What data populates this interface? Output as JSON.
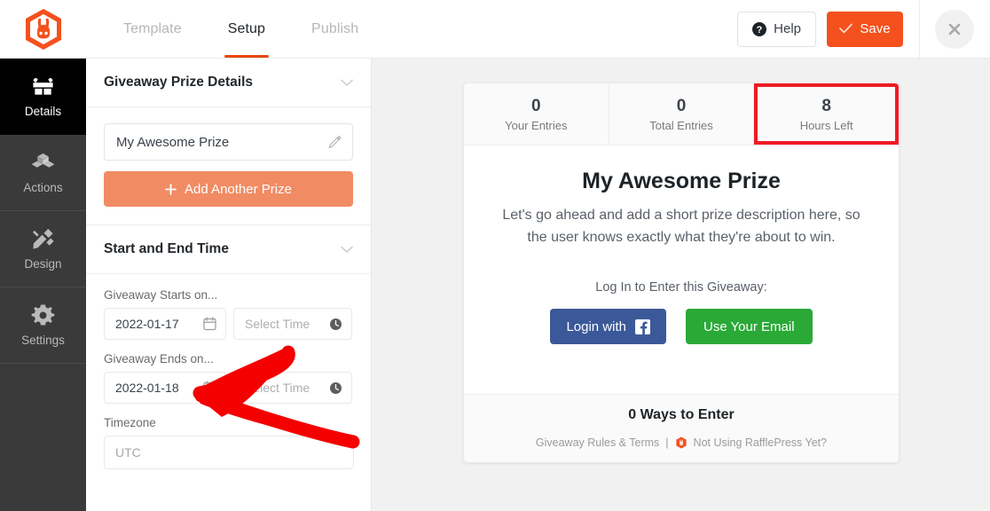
{
  "header": {
    "logo_icon": "rafflepress-bunny-logo",
    "tabs": [
      {
        "label": "Template",
        "active": false
      },
      {
        "label": "Setup",
        "active": true
      },
      {
        "label": "Publish",
        "active": false
      }
    ],
    "help_label": "Help",
    "help_icon": "question-circle-icon",
    "save_label": "Save",
    "save_icon": "check-icon",
    "close_icon": "close-icon",
    "accent_color": "#f4511e"
  },
  "sidenav": {
    "items": [
      {
        "label": "Details",
        "icon": "gift-icon",
        "active": true
      },
      {
        "label": "Actions",
        "icon": "blocks-icon",
        "active": false
      },
      {
        "label": "Design",
        "icon": "pencil-ruler-icon",
        "active": false
      },
      {
        "label": "Settings",
        "icon": "gear-icon",
        "active": false
      }
    ]
  },
  "panel": {
    "prize_section": {
      "title": "Giveaway Prize Details",
      "chevron_icon": "chevron-down-icon",
      "prize_name": "My Awesome Prize",
      "edit_icon": "pencil-icon",
      "add_prize_label": "Add Another Prize",
      "add_prize_icon": "plus-icon",
      "add_prize_color": "#f18b63"
    },
    "time_section": {
      "title": "Start and End Time",
      "chevron_icon": "chevron-down-icon",
      "starts_label": "Giveaway Starts on...",
      "start_date": "2022-01-17",
      "start_time_placeholder": "Select Time",
      "ends_label": "Giveaway Ends on...",
      "end_date": "2022-01-18",
      "end_time_placeholder": "Select Time",
      "calendar_icon": "calendar-icon",
      "clock_icon": "clock-icon",
      "timezone_label": "Timezone",
      "timezone_placeholder": "UTC"
    }
  },
  "preview": {
    "stats": [
      {
        "value": "0",
        "label": "Your Entries",
        "highlighted": false
      },
      {
        "value": "0",
        "label": "Total Entries",
        "highlighted": false
      },
      {
        "value": "8",
        "label": "Hours Left",
        "highlighted": true
      }
    ],
    "highlight_color": "#ee1b24",
    "prize_title": "My Awesome Prize",
    "prize_description": "Let's go ahead and add a short prize description here, so the user knows exactly what they're about to win.",
    "login_label": "Log In to Enter this Giveaway:",
    "facebook_label": "Login with",
    "facebook_icon": "facebook-icon",
    "facebook_color": "#3b5998",
    "email_label": "Use Your Email",
    "email_color": "#2aa937",
    "ways_to_enter": "0 Ways to Enter",
    "footer_rules": "Giveaway Rules & Terms",
    "footer_separator": "|",
    "footer_logo_icon": "rafflepress-bunny-logo",
    "footer_promo": "Not Using RafflePress Yet?"
  },
  "annotation": {
    "shape": "red-arrow-pointing-left",
    "color": "#f40000"
  }
}
